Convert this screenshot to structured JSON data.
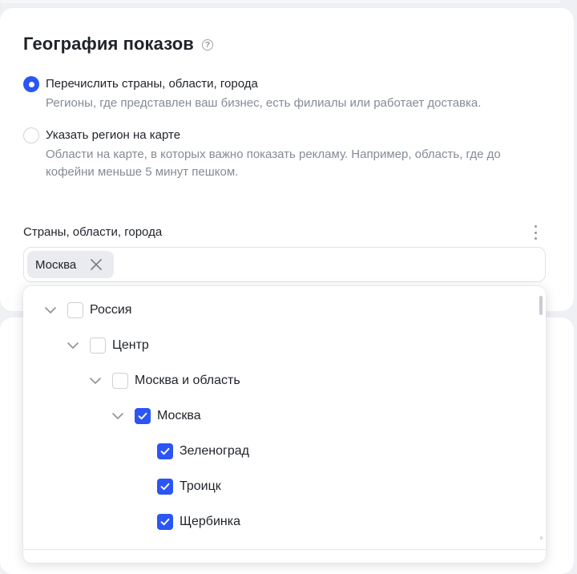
{
  "section": {
    "title": "География показов",
    "help_icon": "question-circle-icon"
  },
  "options": [
    {
      "label": "Перечислить страны, области, города",
      "description": "Регионы, где представлен ваш бизнес, есть филиалы или работает доставка.",
      "selected": true
    },
    {
      "label": "Указать регион на карте",
      "description": "Области на карте, в которых важно показать рекламу. Например, область, где до кофейни меньше 5 минут пешком.",
      "selected": false
    }
  ],
  "regions_field": {
    "label": "Страны, области, города",
    "chips": [
      {
        "label": "Москва"
      }
    ]
  },
  "tree": [
    {
      "label": "Россия",
      "level": 0,
      "expanded": true,
      "checked": false
    },
    {
      "label": "Центр",
      "level": 1,
      "expanded": true,
      "checked": false
    },
    {
      "label": "Москва и область",
      "level": 2,
      "expanded": true,
      "checked": false
    },
    {
      "label": "Москва",
      "level": 3,
      "expanded": true,
      "checked": true
    },
    {
      "label": "Зеленоград",
      "level": 4,
      "checked": true
    },
    {
      "label": "Троицк",
      "level": 4,
      "checked": true
    },
    {
      "label": "Щербинка",
      "level": 4,
      "checked": true
    }
  ],
  "colors": {
    "accent": "#2b55f5",
    "text": "#1f2329",
    "secondary_text": "#858b95",
    "background": "#eef0f4"
  }
}
